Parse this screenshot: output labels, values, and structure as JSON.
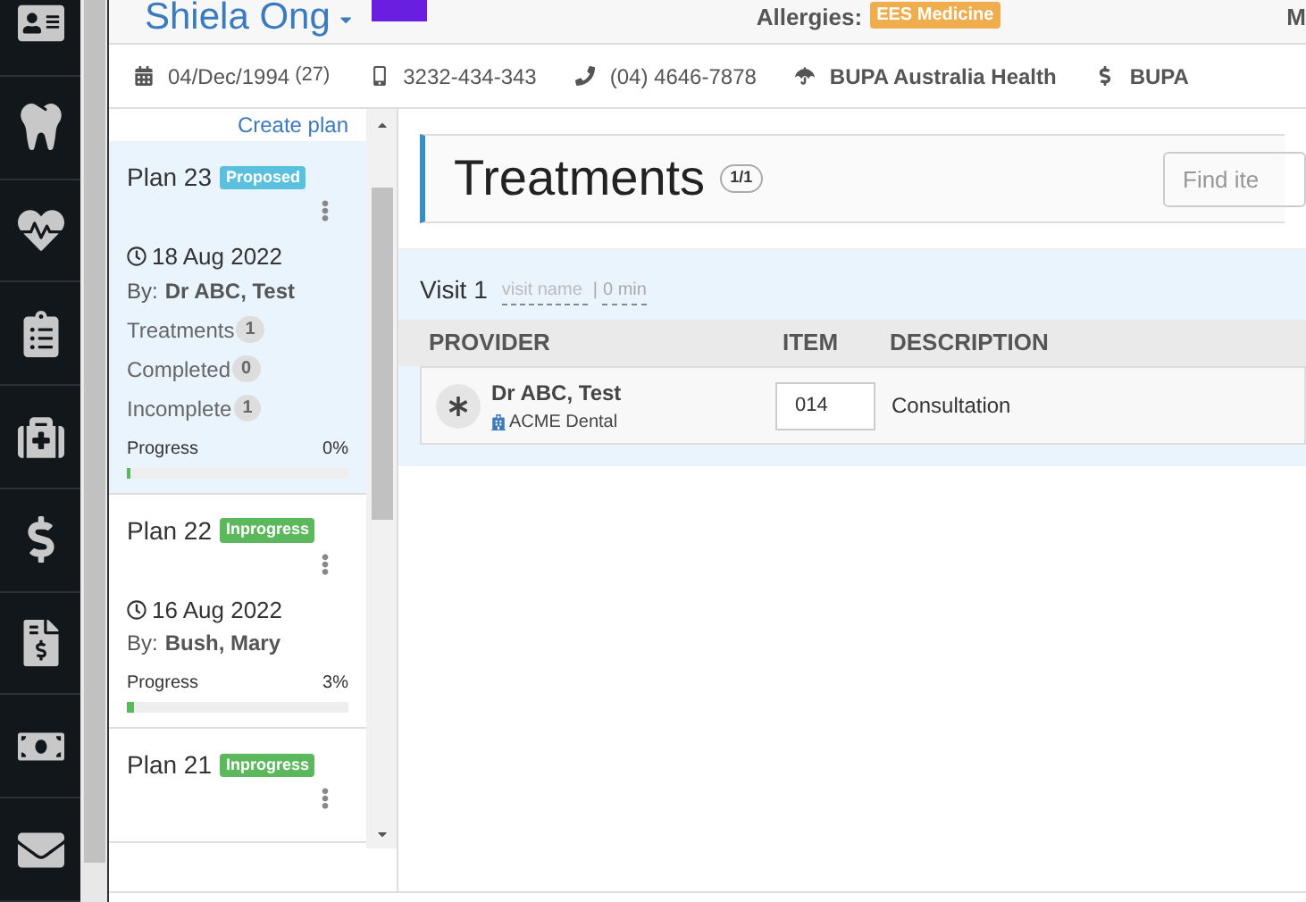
{
  "patient": {
    "name": "Shiela Ong",
    "allergies_label": "Allergies:",
    "allergy": "EES Medicine",
    "cut_label": "M"
  },
  "info_bar": [
    {
      "kind": "dob",
      "text": "04/Dec/1994",
      "extra": "(27)"
    },
    {
      "kind": "mobile",
      "text": "3232-434-343"
    },
    {
      "kind": "phone",
      "text": "(04) 4646-7878"
    },
    {
      "kind": "insurer",
      "text": "BUPA Australia Health"
    },
    {
      "kind": "billing",
      "text": "BUPA"
    }
  ],
  "plans_panel": {
    "create_label": "Create plan",
    "plans": [
      {
        "title": "Plan 23",
        "status": "Proposed",
        "color": "#5bc0de",
        "selected": true,
        "date": "18 Aug 2022",
        "by_label": "By:",
        "by": "Dr ABC, Test",
        "stats": [
          {
            "label": "Treatments",
            "count": "1"
          },
          {
            "label": "Completed",
            "count": "0"
          },
          {
            "label": "Incomplete",
            "count": "1"
          }
        ],
        "progress_label": "Progress",
        "progress_text": "0%",
        "level": 0
      },
      {
        "title": "Plan 22",
        "status": "Inprogress",
        "color": "#5cb85c",
        "selected": false,
        "date": "16 Aug 2022",
        "by_label": "By:",
        "by": "Bush, Mary",
        "progress_label": "Progress",
        "progress_text": "3%",
        "level": 0.03
      },
      {
        "title": "Plan 21",
        "status": "Inprogress",
        "color": "#5cb85c",
        "selected": false
      }
    ]
  },
  "treatments": {
    "title": "Treatments",
    "count": "1/1",
    "search_placeholder": "Find ite",
    "visit": {
      "title": "Visit 1",
      "name_placeholder": "visit name",
      "separator": "|",
      "duration": "0 min"
    },
    "columns": [
      "PROVIDER",
      "ITEM",
      "DESCRIPTION"
    ],
    "rows": [
      {
        "provider": "Dr ABC, Test",
        "location": "ACME Dental",
        "item": "014",
        "description": "Consultation"
      }
    ]
  }
}
